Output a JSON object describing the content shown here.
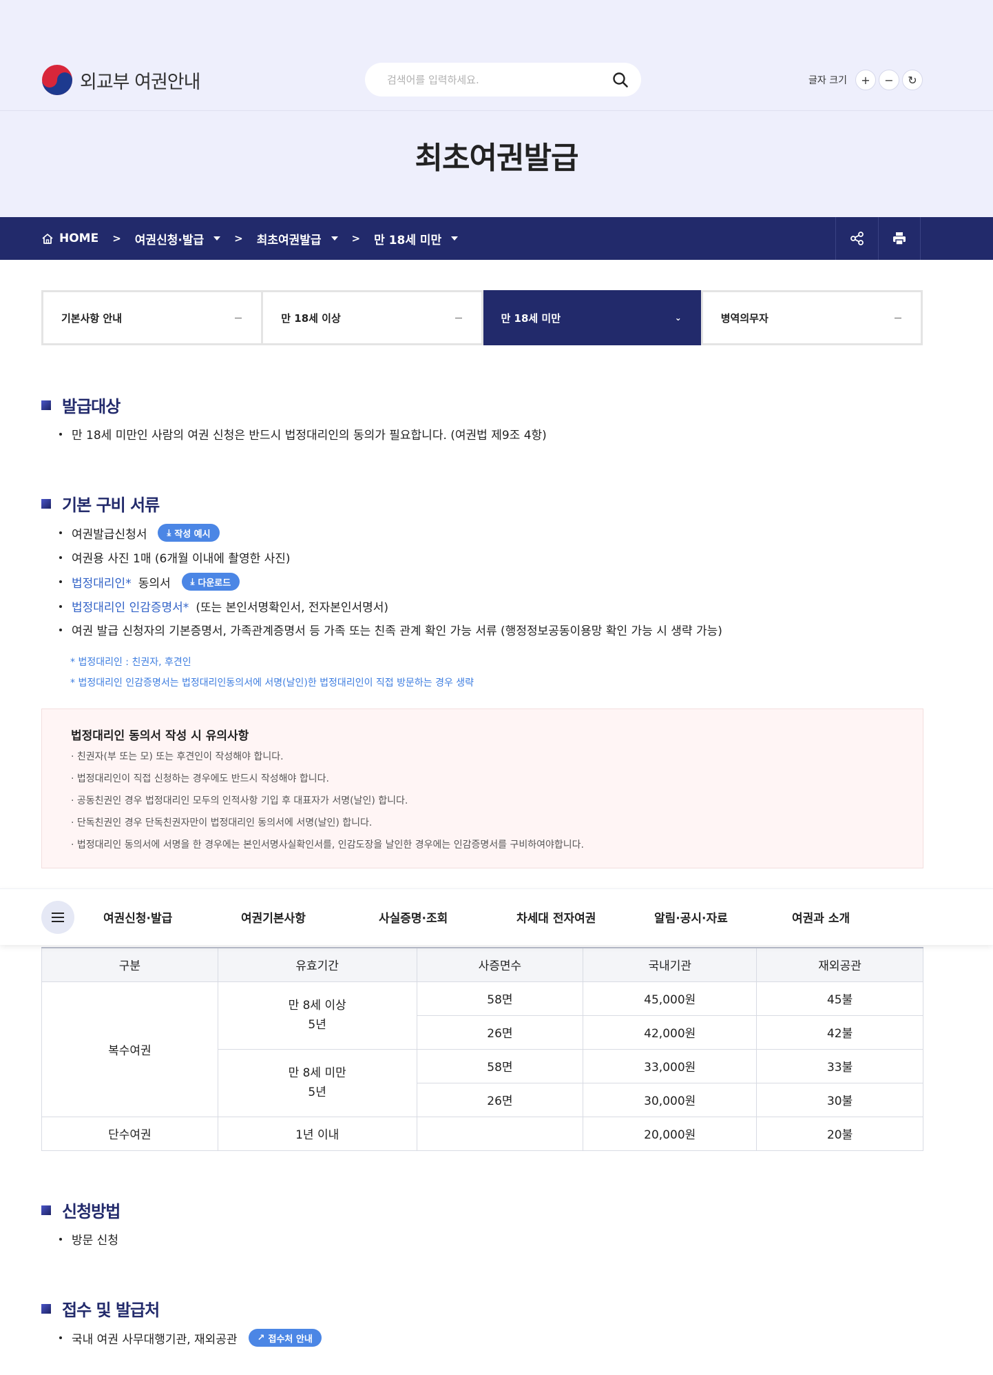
{
  "header": {
    "logo_text": "외교부 여권안내",
    "search_placeholder": "검색어를 입력하세요.",
    "font_size_label": "글자 크기",
    "font_plus": "+",
    "font_minus": "−",
    "font_reset": "↻"
  },
  "page_title": "최초여권발급",
  "breadcrumb": {
    "home": "HOME",
    "level1": "여권신청·발급",
    "level2": "최초여권발급",
    "level3": "만 18세 미만",
    "separator": ">"
  },
  "tabs": [
    {
      "label": "기본사항 안내",
      "active": false
    },
    {
      "label": "만 18세 이상",
      "active": false
    },
    {
      "label": "만 18세 미만",
      "active": true
    },
    {
      "label": "병역의무자",
      "active": false
    }
  ],
  "sections": {
    "target": {
      "title": "발급대상",
      "text": "만 18세 미만인 사람의 여권 신청은 반드시 법정대리인의 동의가 필요합니다. (여권법 제9조 4항)"
    },
    "documents": {
      "title": "기본 구비 서류",
      "item1": "여권발급신청서",
      "item1_button": "작성 예시",
      "item2": "여권용 사진 1매 (6개월 이내에 촬영한 사진)",
      "item3_link": "법정대리인*",
      "item3_rest": "동의서",
      "item3_button": "다운로드",
      "item4_link": "법정대리인 인감증명서*",
      "item4_rest": "(또는 본인서명확인서, 전자본인서명서)",
      "item5": "여권 발급 신청자의 기본증명서, 가족관계증명서 등 가족 또는 친족 관계 확인 가능 서류 (행정정보공동이용망 확인 가능 시 생략 가능)",
      "note1": "* 법정대리인 : 친권자, 후견인",
      "note2": "* 법정대리인 인감증명서는 법정대리인동의서에 서명(날인)한 법정대리인이 직접 방문하는 경우 생략"
    },
    "notice": {
      "title": "법정대리인 동의서 작성 시 유의사항",
      "lines": [
        "· 친권자(부 또는 모) 또는 후견인이 작성해야 합니다.",
        "· 법정대리인이 직접 신청하는 경우에도 반드시 작성해야 합니다.",
        "· 공동친권인 경우 법정대리인 모두의 인적사항 기입 후 대표자가 서명(날인) 합니다.",
        "· 단독친권인 경우 단독친권자만이 법정대리인 동의서에 서명(날인) 합니다.",
        "· 법정대리인 동의서에 서명을 한 경우에는 본인서명사실확인서를, 인감도장을 날인한 경우에는 인감증명서를 구비하여야합니다."
      ]
    },
    "method": {
      "title": "신청방법",
      "text": "방문 신청"
    },
    "office": {
      "title": "접수 및 발급처",
      "text": "국내 여권 사무대행기관, 재외공관",
      "button": "접수처 안내"
    }
  },
  "gnb": [
    "여권신청·발급",
    "여권기본사항",
    "사실증명·조회",
    "차세대 전자여권",
    "알림·공시·자료",
    "여권과 소개"
  ],
  "fee_table": {
    "headers": [
      "구분",
      "유효기간",
      "사증면수",
      "국내기관",
      "재외공관"
    ],
    "multi_label": "복수여권",
    "over8_l1": "만 8세 이상",
    "over8_l2": "5년",
    "under8_l1": "만 8세 미만",
    "under8_l2": "5년",
    "rows": [
      {
        "pages": "58면",
        "domestic": "45,000원",
        "overseas": "45불"
      },
      {
        "pages": "26면",
        "domestic": "42,000원",
        "overseas": "42불"
      },
      {
        "pages": "58면",
        "domestic": "33,000원",
        "overseas": "33불"
      },
      {
        "pages": "26면",
        "domestic": "30,000원",
        "overseas": "30불"
      }
    ],
    "single": {
      "label": "단수여권",
      "validity": "1년 이내",
      "pages": "",
      "domestic": "20,000원",
      "overseas": "20불"
    }
  },
  "colors": {
    "banner_bg": "#eeeffc",
    "navy": "#222a6b",
    "accent_blue": "#4b86e5",
    "link_blue": "#3162c7",
    "notice_bg": "#fff5f5"
  }
}
